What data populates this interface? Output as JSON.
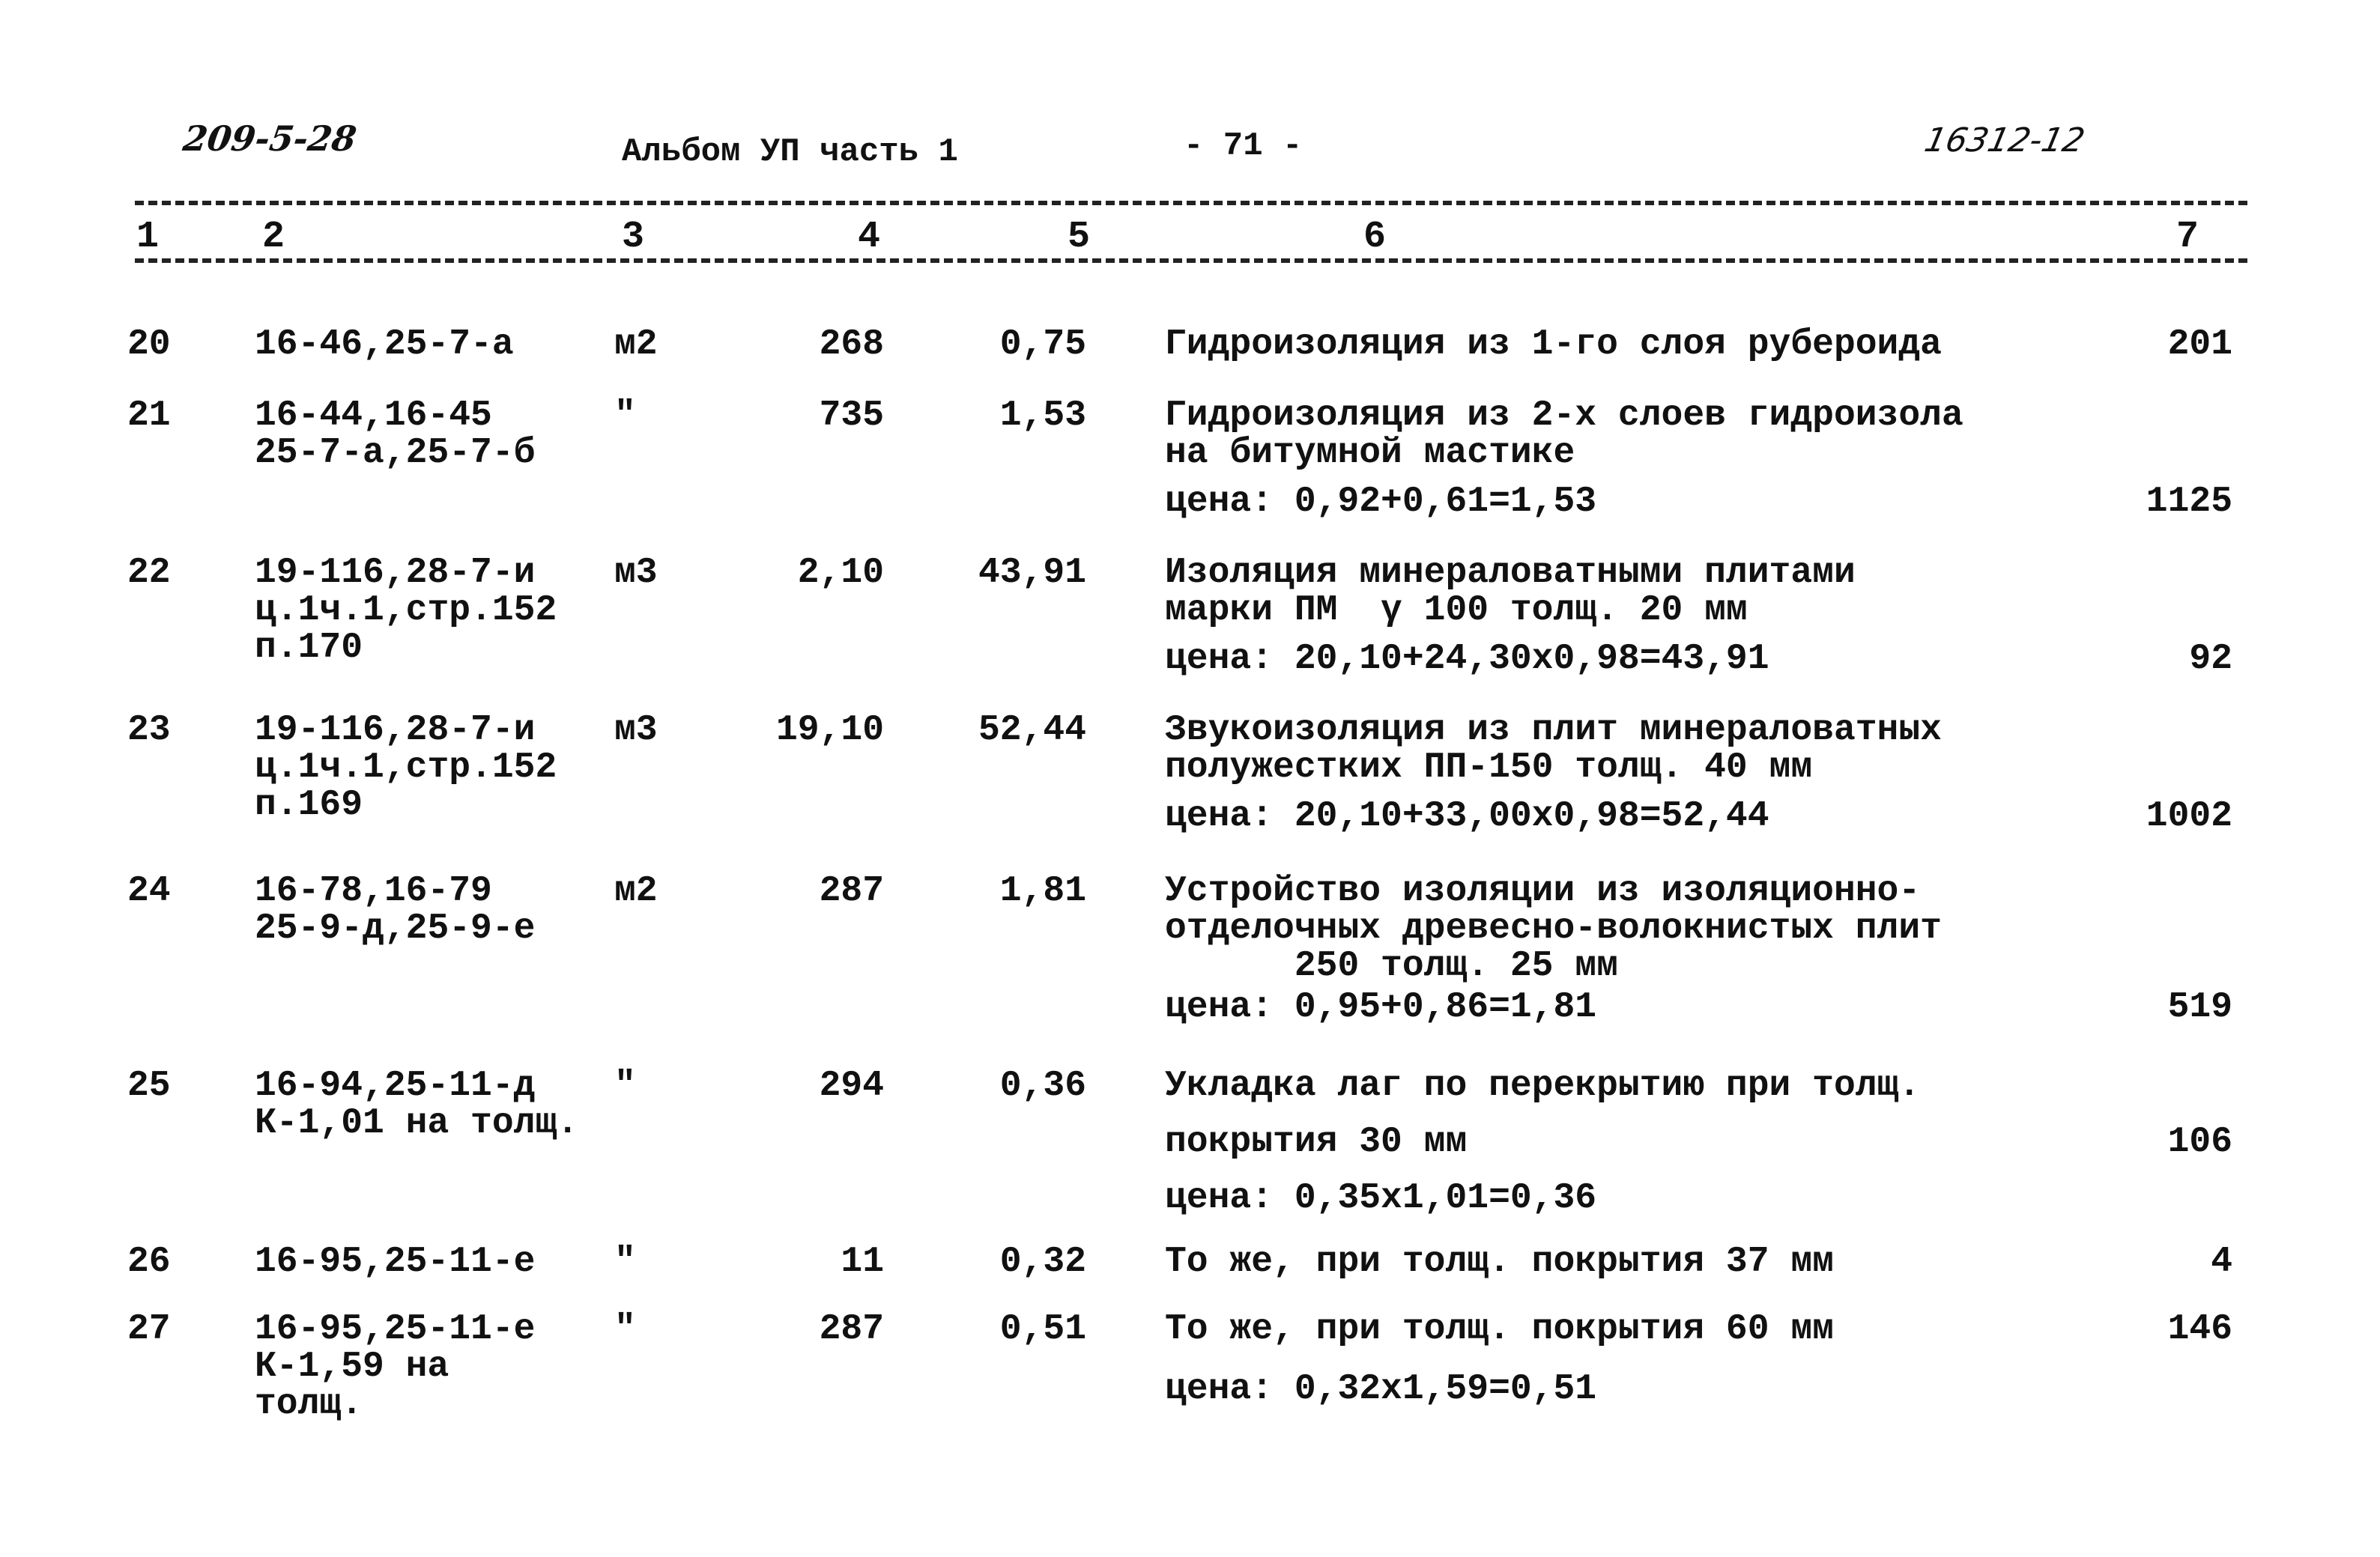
{
  "header": {
    "doc_code": "209-5-28",
    "album": "Альбом УП  часть 1",
    "page": "- 71 -",
    "inventory": "16312-12"
  },
  "column_numbers": [
    "1",
    "2",
    "3",
    "4",
    "5",
    "6",
    "7"
  ],
  "rows": [
    {
      "num": "20",
      "code": "16-46,25-7-а",
      "unit": "м2",
      "qty": "268",
      "price": "0,75",
      "desc": "Гидроизоляция из 1-го слоя рубероида",
      "calc": "",
      "total": "201"
    },
    {
      "num": "21",
      "code": "16-44,16-45\n25-7-а,25-7-б",
      "unit": "\"",
      "qty": "735",
      "price": "1,53",
      "desc": "Гидроизоляция из 2-х слоев гидроизола\nна битумной мастике",
      "calc": "цена: 0,92+0,61=1,53",
      "total": "1125"
    },
    {
      "num": "22",
      "code": "19-116,28-7-и\nц.1ч.1,стр.152\nп.170",
      "unit": "м3",
      "qty": "2,10",
      "price": "43,91",
      "desc": "Изоляция минераловатными плитами\nмарки ПМ  γ 100 толщ. 20 мм",
      "calc": "цена: 20,10+24,30х0,98=43,91",
      "total": "92"
    },
    {
      "num": "23",
      "code": "19-116,28-7-и\nц.1ч.1,стр.152\nп.169",
      "unit": "м3",
      "qty": "19,10",
      "price": "52,44",
      "desc": "Звукоизоляция из плит минераловатных\nполужестких ПП-150 толщ. 40 мм",
      "calc": "цена: 20,10+33,00х0,98=52,44",
      "total": "1002"
    },
    {
      "num": "24",
      "code": "16-78,16-79\n25-9-д,25-9-е",
      "unit": "м2",
      "qty": "287",
      "price": "1,81",
      "desc": "Устройство изоляции из изоляционно-\nотделочных древесно-волокнистых плит\n      250 толщ. 25 мм",
      "calc": "цена: 0,95+0,86=1,81",
      "total": "519"
    },
    {
      "num": "25",
      "code": "16-94,25-11-д\nК-1,01 на толщ.",
      "unit": "\"",
      "qty": "294",
      "price": "0,36",
      "desc": "Укладка лаг по перекрытию при толщ.",
      "desc2": "покрытия 30 мм",
      "calc": "цена: 0,35х1,01=0,36",
      "total": "106"
    },
    {
      "num": "26",
      "code": "16-95,25-11-е",
      "unit": "\"",
      "qty": "11",
      "price": "0,32",
      "desc": "То же, при толщ. покрытия 37 мм",
      "calc": "",
      "total": "4"
    },
    {
      "num": "27",
      "code": "16-95,25-11-е\nК-1,59 на\nтолщ.",
      "unit": "\"",
      "qty": "287",
      "price": "0,51",
      "desc": "То же, при толщ. покрытия 60 мм",
      "calc": "цена: 0,32х1,59=0,51",
      "total": "146"
    }
  ]
}
